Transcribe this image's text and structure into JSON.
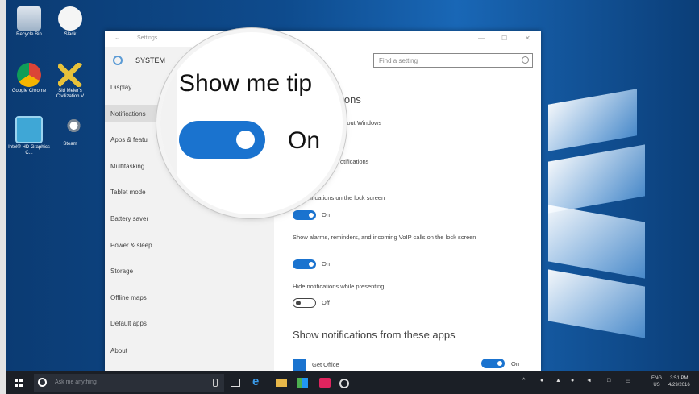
{
  "desktop": {
    "icons": [
      {
        "label": "Recycle Bin"
      },
      {
        "label": "Slack"
      },
      {
        "label": "Google Chrome"
      },
      {
        "label": "Sid Meier's Civilization V"
      },
      {
        "label": "Intel® HD Graphics C..."
      },
      {
        "label": "Steam"
      }
    ]
  },
  "window": {
    "title": "Settings",
    "back_glyph": "←",
    "min_glyph": "—",
    "max_glyph": "☐",
    "close_glyph": "✕",
    "section": "SYSTEM",
    "search_placeholder": "Find a setting",
    "nav": [
      "Display",
      "Notifications & actions",
      "Apps & features",
      "Multitasking",
      "Tablet mode",
      "Battery saver",
      "Power & sleep",
      "Storage",
      "Offline maps",
      "Default apps",
      "About"
    ],
    "nav_visible": [
      "Display",
      "Notifications",
      "Apps & featu",
      "Multitasking",
      "Tablet mode",
      "Battery saver",
      "Power & sleep",
      "Storage",
      "Offline maps",
      "Default apps",
      "About"
    ],
    "active_nav": "Notifications"
  },
  "content": {
    "heading_partial": "ions",
    "tips_partial": "about Windows",
    "app_notif_partial": "otifications",
    "app_notif_state": "On",
    "lock_screen_label": "ow notifications on the lock screen",
    "lock_screen_state": "On",
    "alarms_label": "Show alarms, reminders, and incoming VoIP calls on the lock screen",
    "alarms_state": "On",
    "hide_label": "Hide notifications while presenting",
    "hide_state": "Off",
    "apps_heading": "Show notifications from these apps",
    "app_name": "Get Office",
    "app_state": "On"
  },
  "magnifier": {
    "label": "Show me tip",
    "state": "On"
  },
  "taskbar": {
    "search_placeholder": "Ask me anything",
    "lang_top": "ENG",
    "lang_bottom": "US",
    "time": "3:51 PM",
    "date": "4/29/2016",
    "colors": {
      "taskbar": "#1b1f26",
      "accent": "#1a73cf"
    }
  }
}
